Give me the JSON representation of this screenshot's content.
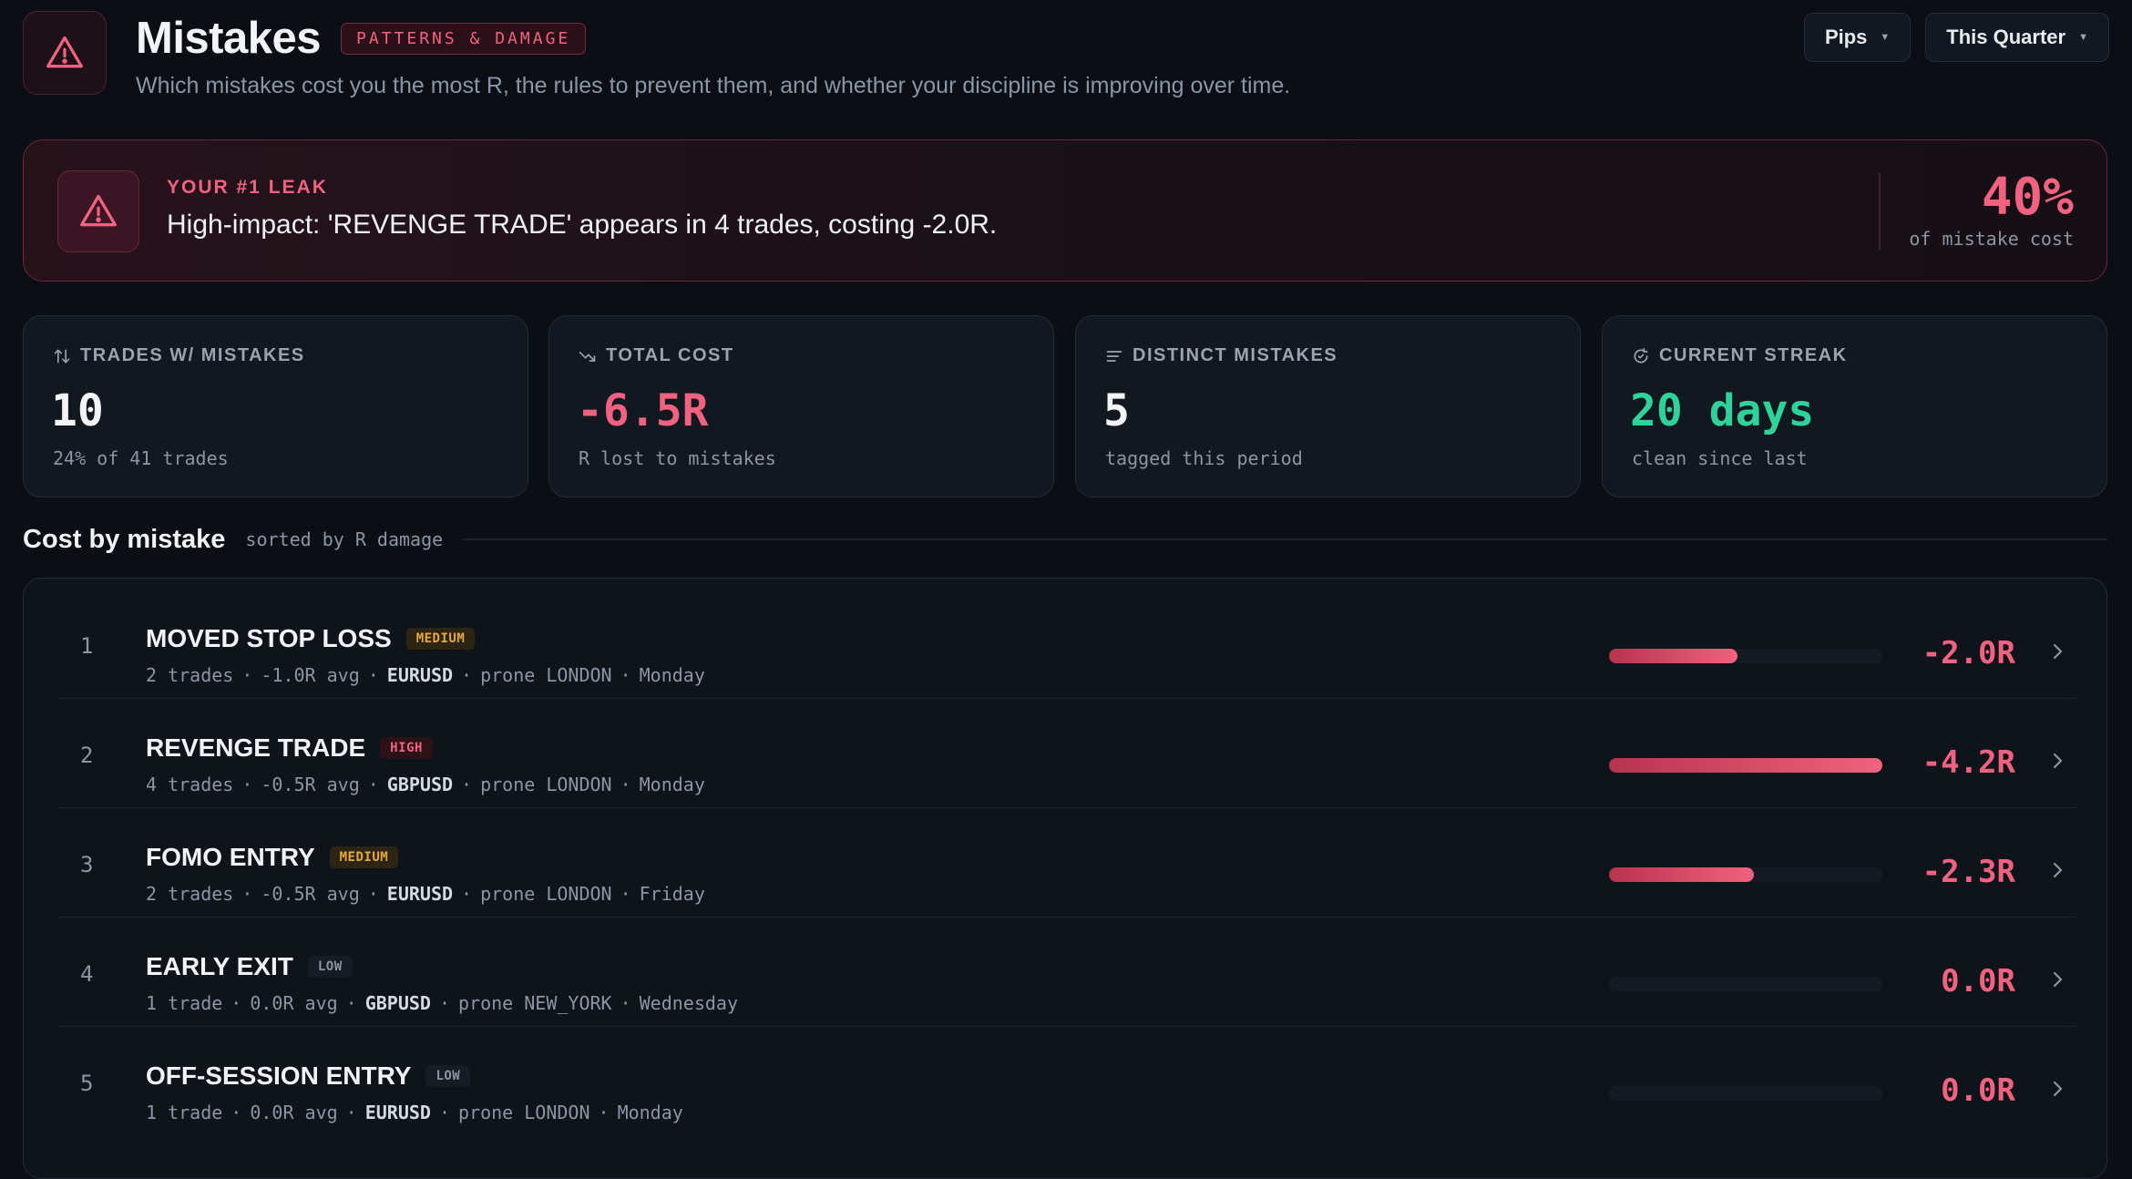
{
  "header": {
    "title": "Mistakes",
    "badge": "PATTERNS & DAMAGE",
    "subtitle": "Which mistakes cost you the most R, the rules to prevent them, and whether your discipline is improving over time.",
    "unit_selector": "Pips",
    "period_selector": "This Quarter"
  },
  "leak": {
    "label": "YOUR #1 LEAK",
    "text": "High-impact: 'REVENGE TRADE' appears in 4 trades, costing -2.0R.",
    "percent": "40%",
    "percent_sub": "of mistake cost"
  },
  "stats": [
    {
      "label": "TRADES W/ MISTAKES",
      "value": "10",
      "sub": "24% of 41 trades",
      "icon": "sort-arrows-icon"
    },
    {
      "label": "TOTAL COST",
      "value": "-6.5R",
      "sub": "R lost to mistakes",
      "icon": "trending-down-icon"
    },
    {
      "label": "DISTINCT MISTAKES",
      "value": "5",
      "sub": "tagged this period",
      "icon": "list-lines-icon"
    },
    {
      "label": "CURRENT STREAK",
      "value": "20 days",
      "sub": "clean since last",
      "icon": "refresh-check-icon"
    }
  ],
  "section": {
    "title": "Cost by mistake",
    "subtitle": "sorted by R damage"
  },
  "mistakes": [
    {
      "rank": "1",
      "name": "MOVED STOP LOSS",
      "severity": "MEDIUM",
      "trades": "2 trades",
      "avg": "-1.0R avg",
      "pair": "EURUSD",
      "session": "prone LONDON",
      "day": "Monday",
      "cost": "-2.0R",
      "bar_fraction": 0.47
    },
    {
      "rank": "2",
      "name": "REVENGE TRADE",
      "severity": "HIGH",
      "trades": "4 trades",
      "avg": "-0.5R avg",
      "pair": "GBPUSD",
      "session": "prone LONDON",
      "day": "Monday",
      "cost": "-4.2R",
      "bar_fraction": 1.0
    },
    {
      "rank": "3",
      "name": "FOMO ENTRY",
      "severity": "MEDIUM",
      "trades": "2 trades",
      "avg": "-0.5R avg",
      "pair": "EURUSD",
      "session": "prone LONDON",
      "day": "Friday",
      "cost": "-2.3R",
      "bar_fraction": 0.53
    },
    {
      "rank": "4",
      "name": "EARLY EXIT",
      "severity": "LOW",
      "trades": "1 trade",
      "avg": "0.0R avg",
      "pair": "GBPUSD",
      "session": "prone NEW_YORK",
      "day": "Wednesday",
      "cost": "0.0R",
      "bar_fraction": 0.0
    },
    {
      "rank": "5",
      "name": "OFF-SESSION ENTRY",
      "severity": "LOW",
      "trades": "1 trade",
      "avg": "0.0R avg",
      "pair": "EURUSD",
      "session": "prone LONDON",
      "day": "Monday",
      "cost": "0.0R",
      "bar_fraction": 0.0
    }
  ],
  "colors": {
    "accent_red": "#f0627f",
    "accent_green": "#2fd39a",
    "severity_medium": "#e6a840",
    "background": "#0b0f15"
  }
}
